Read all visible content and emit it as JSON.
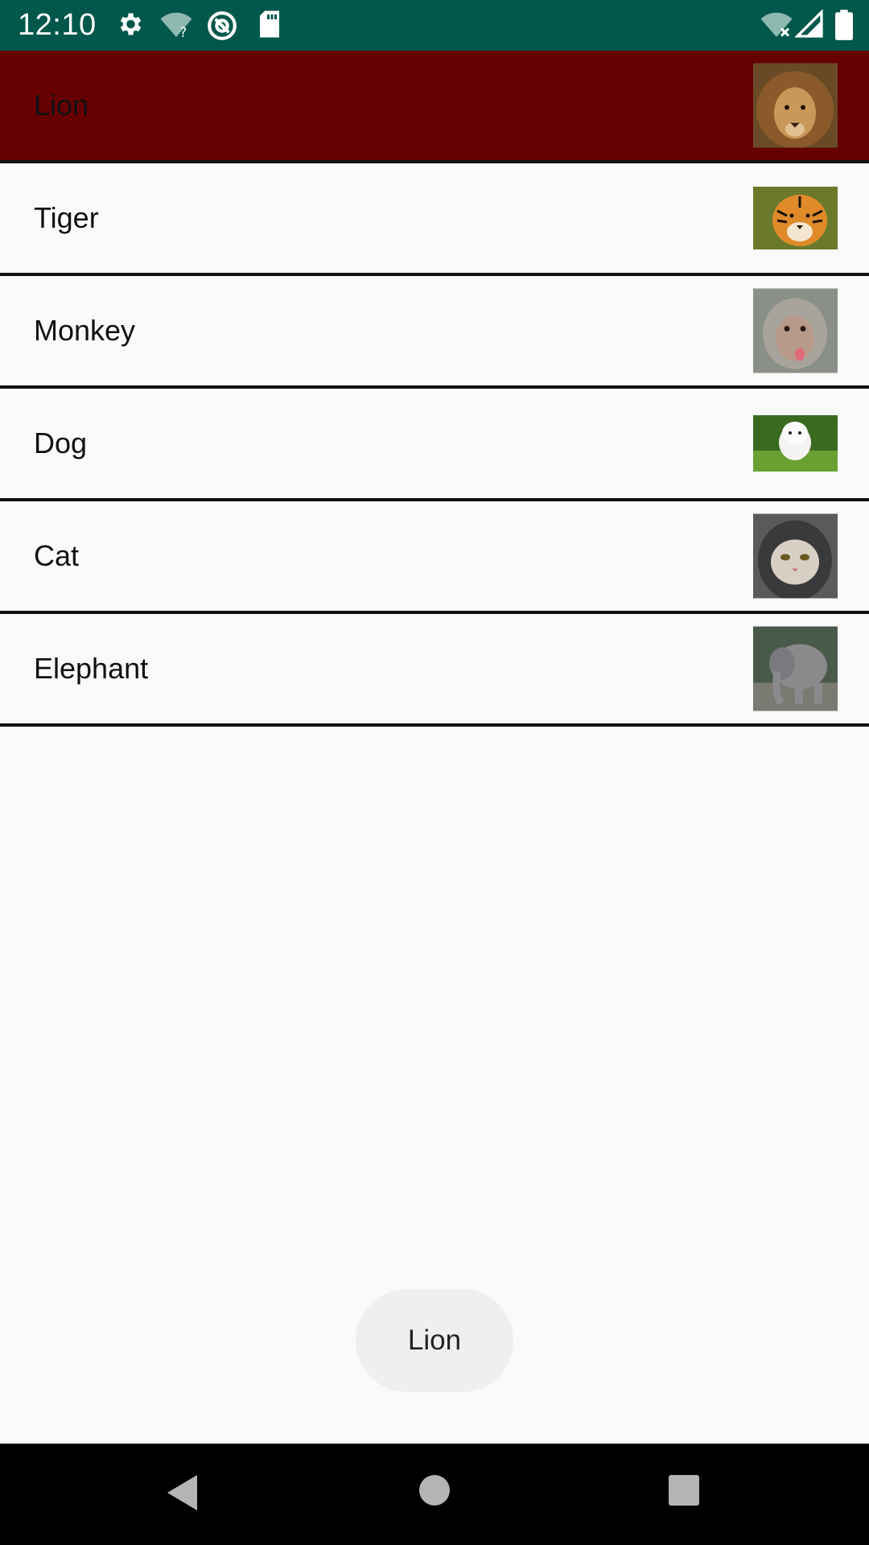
{
  "status_bar": {
    "time": "12:10",
    "icons_left": [
      "gear-icon",
      "wifi-question-icon",
      "at-sign-icon",
      "sd-card-icon"
    ],
    "icons_right": [
      "wifi-off-icon",
      "cell-signal-icon",
      "battery-icon"
    ],
    "background": "#00574b"
  },
  "list": {
    "selected_color": "#660000",
    "items": [
      {
        "label": "Lion",
        "image": "lion-image",
        "selected": true
      },
      {
        "label": "Tiger",
        "image": "tiger-image",
        "selected": false
      },
      {
        "label": "Monkey",
        "image": "monkey-image",
        "selected": false
      },
      {
        "label": "Dog",
        "image": "dog-image",
        "selected": false
      },
      {
        "label": "Cat",
        "image": "cat-image",
        "selected": false
      },
      {
        "label": "Elephant",
        "image": "elephant-image",
        "selected": false
      }
    ]
  },
  "toast": {
    "text": "Lion"
  },
  "nav_bar": {
    "buttons": [
      "back-icon",
      "home-icon",
      "recents-icon"
    ]
  }
}
